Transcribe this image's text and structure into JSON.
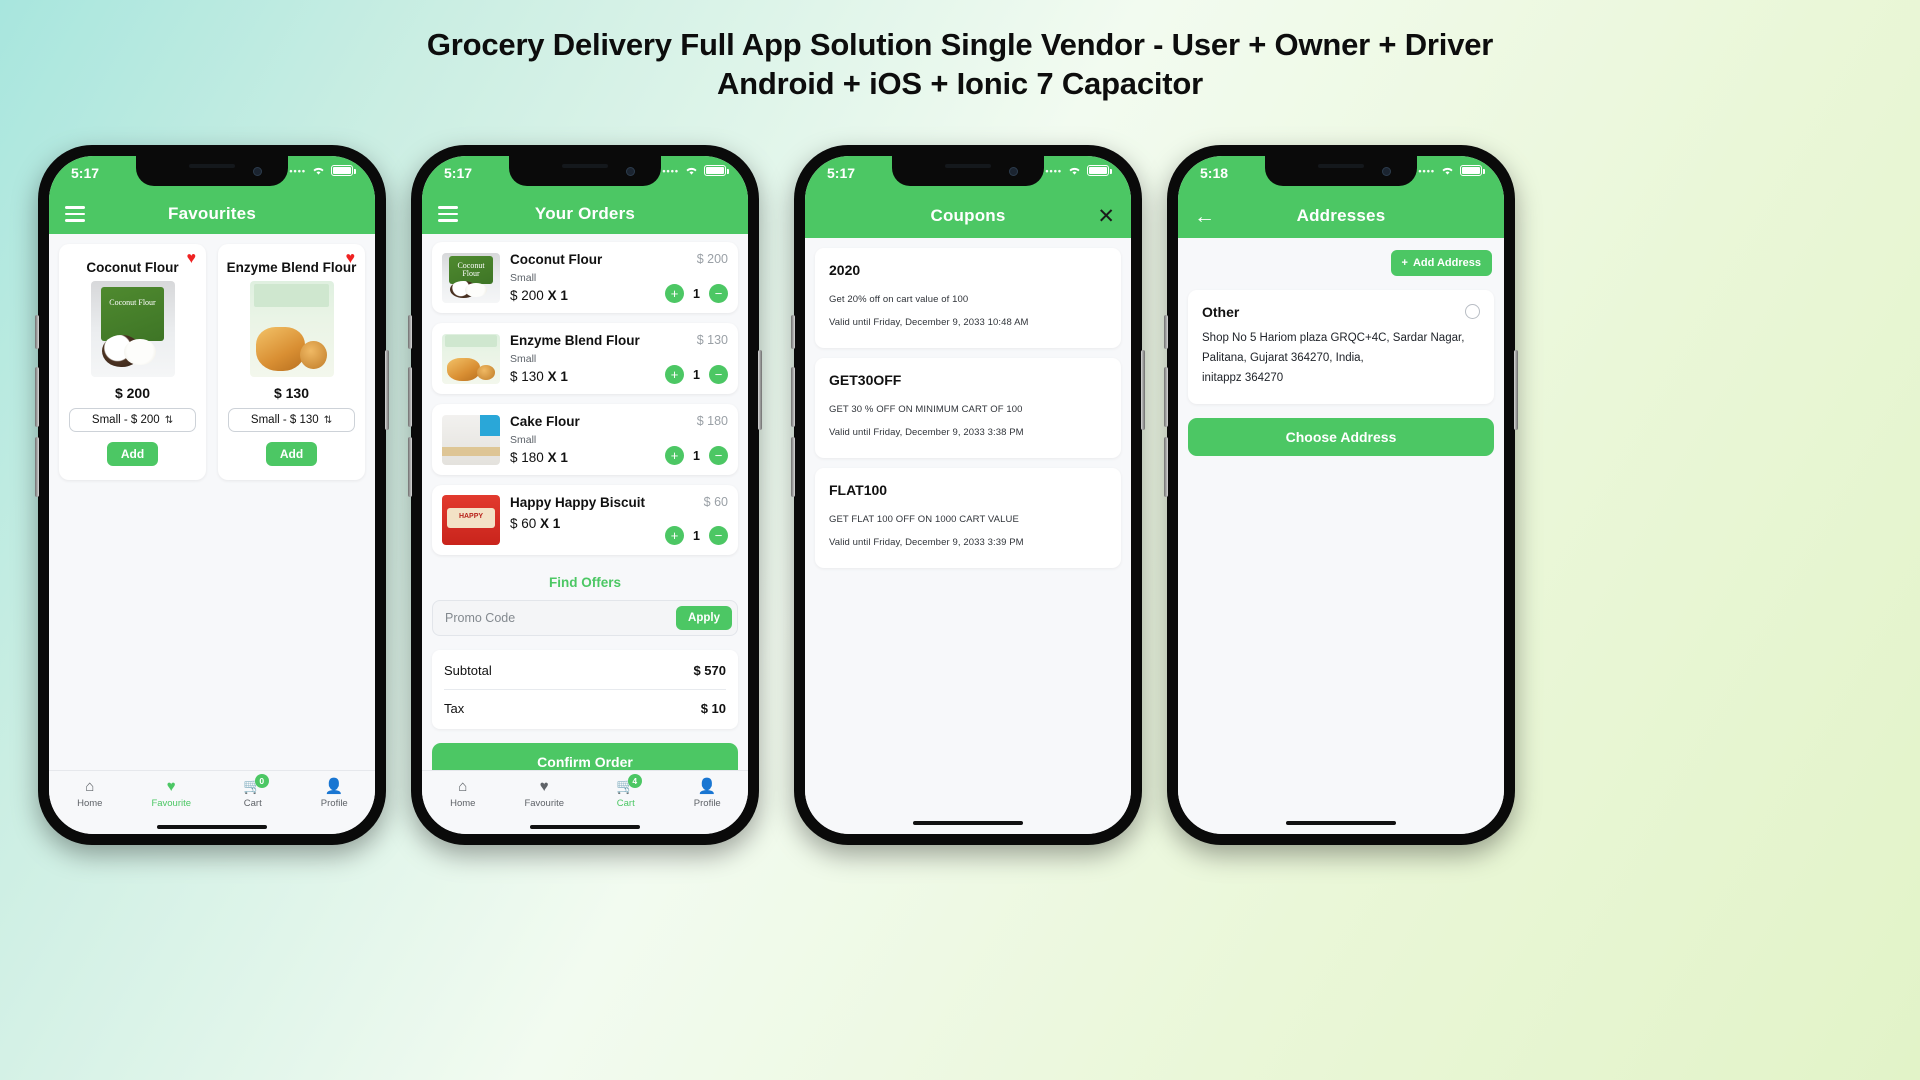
{
  "headline": {
    "line1": "Grocery Delivery Full App Solution Single Vendor - User + Owner + Driver",
    "line2": "Android + iOS + Ionic 7 Capacitor"
  },
  "colors": {
    "brand_green": "#4cc764",
    "heart_red": "#ef2222",
    "screen_bg": "#f7f8fa"
  },
  "phones": [
    {
      "status": {
        "time": "5:17"
      },
      "header": {
        "title": "Favourites",
        "menu_icon": "hamburger-icon"
      },
      "favourites": [
        {
          "name": "Coconut Flour",
          "price": "$ 200",
          "variant": "Small  -  $ 200",
          "add_label": "Add",
          "favourite_icon": "heart-icon",
          "art": "coconut"
        },
        {
          "name": "Enzyme Blend Flour",
          "price": "$ 130",
          "variant": "Small  -  $ 130",
          "add_label": "Add",
          "favourite_icon": "heart-icon",
          "art": "enzyme"
        }
      ],
      "tabs": [
        {
          "label": "Home",
          "icon": "home-icon",
          "active": false
        },
        {
          "label": "Favourite",
          "icon": "heart-icon",
          "active": true
        },
        {
          "label": "Cart",
          "icon": "cart-icon",
          "active": false,
          "badge": "0"
        },
        {
          "label": "Profile",
          "icon": "person-icon",
          "active": false
        }
      ]
    },
    {
      "status": {
        "time": "5:17"
      },
      "header": {
        "title": "Your Orders",
        "menu_icon": "hamburger-icon"
      },
      "orders": [
        {
          "name": "Coconut Flour",
          "size": "Small",
          "line_price": "$ 200",
          "multiplier": "X 1",
          "right_price": "$ 200",
          "qty": "1",
          "art": "coconut"
        },
        {
          "name": "Enzyme Blend Flour",
          "size": "Small",
          "line_price": "$ 130",
          "multiplier": "X 1",
          "right_price": "$ 130",
          "qty": "1",
          "art": "enzyme"
        },
        {
          "name": "Cake Flour",
          "size": "Small",
          "line_price": "$ 180",
          "multiplier": "X 1",
          "right_price": "$ 180",
          "qty": "1",
          "art": "cake"
        },
        {
          "name": "Happy Happy Biscuit",
          "size": "",
          "line_price": "$ 60",
          "multiplier": "X 1",
          "right_price": "$ 60",
          "qty": "1",
          "art": "biscuit"
        }
      ],
      "find_offers": "Find Offers",
      "promo": {
        "placeholder": "Promo Code",
        "value": "",
        "apply_label": "Apply"
      },
      "totals": [
        {
          "label": "Subtotal",
          "value": "$ 570"
        },
        {
          "label": "Tax",
          "value": "$ 10"
        }
      ],
      "confirm_label": "Confirm Order",
      "tabs": [
        {
          "label": "Home",
          "icon": "home-icon",
          "active": false
        },
        {
          "label": "Favourite",
          "icon": "heart-icon",
          "active": false
        },
        {
          "label": "Cart",
          "icon": "cart-icon",
          "active": true,
          "badge": "4"
        },
        {
          "label": "Profile",
          "icon": "person-icon",
          "active": false
        }
      ]
    },
    {
      "status": {
        "time": "5:17"
      },
      "header": {
        "title": "Coupons",
        "close_icon": "close-icon"
      },
      "coupons": [
        {
          "code": "2020",
          "desc": "Get 20% off on cart value of 100",
          "valid": "Valid until Friday, December 9, 2033 10:48 AM"
        },
        {
          "code": "GET30OFF",
          "desc": "GET 30 % OFF ON MINIMUM CART OF 100",
          "valid": "Valid until Friday, December 9, 2033 3:38 PM"
        },
        {
          "code": "FLAT100",
          "desc": "GET FLAT 100 OFF ON 1000 CART VALUE",
          "valid": "Valid until Friday, December 9, 2033 3:39 PM"
        }
      ]
    },
    {
      "status": {
        "time": "5:18"
      },
      "header": {
        "title": "Addresses",
        "back_icon": "back-arrow-icon"
      },
      "add_address_label": "Add Address",
      "address": {
        "label": "Other",
        "line1": "Shop No 5 Hariom plaza GRQC+4C, Sardar Nagar,",
        "line2": "Palitana, Gujarat 364270, India,",
        "line3": "initappz 364270",
        "selected": false
      },
      "choose_label": "Choose Address"
    }
  ]
}
